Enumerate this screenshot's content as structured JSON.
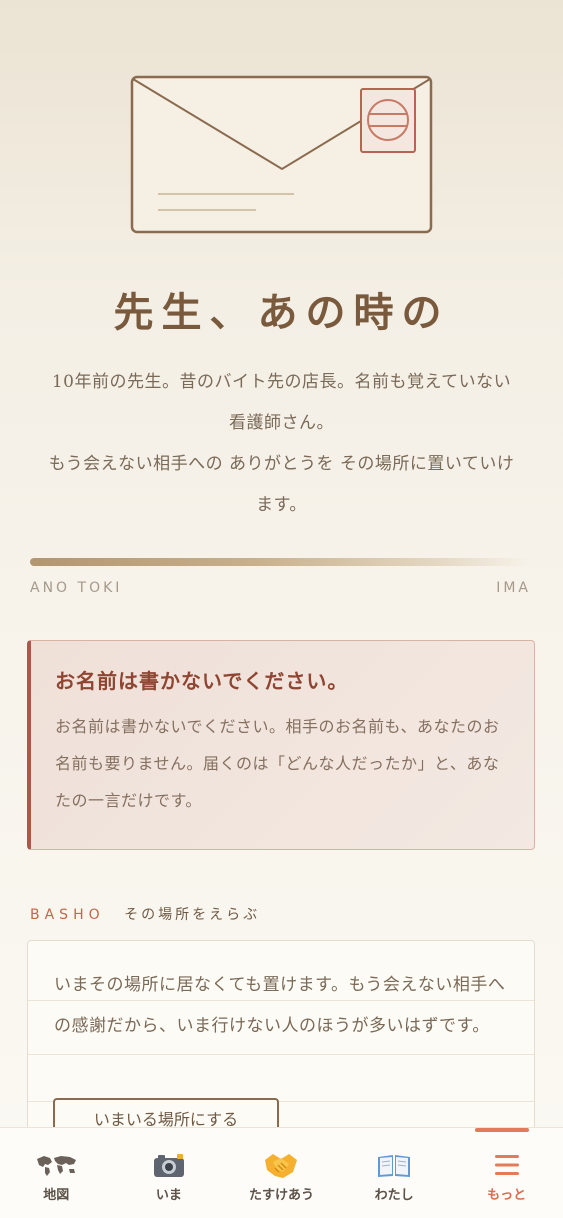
{
  "hero": {
    "title": "先生、あの時の",
    "lead_lines": [
      "10年前の先生。昔のバイト先の店長。名前も覚えていない",
      "看護師さん。",
      "もう会えない相手への ありがとうを その場所に置いていけ",
      "ます。"
    ]
  },
  "timeline": {
    "start_label": "ANO TOKI",
    "end_label": "IMA"
  },
  "notice": {
    "title": "お名前は書かないでください。",
    "body": "お名前は書かないでください。相手のお名前も、あなたのお名前も要りません。届くのは「どんな人だったか」と、あなたの一言だけです。"
  },
  "basho": {
    "label_en": "BASHO",
    "label_ja": "その場所をえらぶ",
    "text": "いまその場所に居なくても置けます。もう会えない相手への感謝だから、いま行けない人のほうが多いはずです。",
    "button_label": "いまいる場所にする"
  },
  "nav": {
    "items": [
      {
        "label": "地図",
        "icon": "world-map-icon",
        "active": false
      },
      {
        "label": "いま",
        "icon": "camera-icon",
        "active": false
      },
      {
        "label": "たすけあう",
        "icon": "handshake-icon",
        "active": false
      },
      {
        "label": "わたし",
        "icon": "open-book-icon",
        "active": false
      },
      {
        "label": "もっと",
        "icon": "menu-icon",
        "active": true
      }
    ]
  },
  "colors": {
    "accent": "#d86e4f",
    "brown": "#7a5a3c",
    "notice_border": "#a9594a"
  }
}
